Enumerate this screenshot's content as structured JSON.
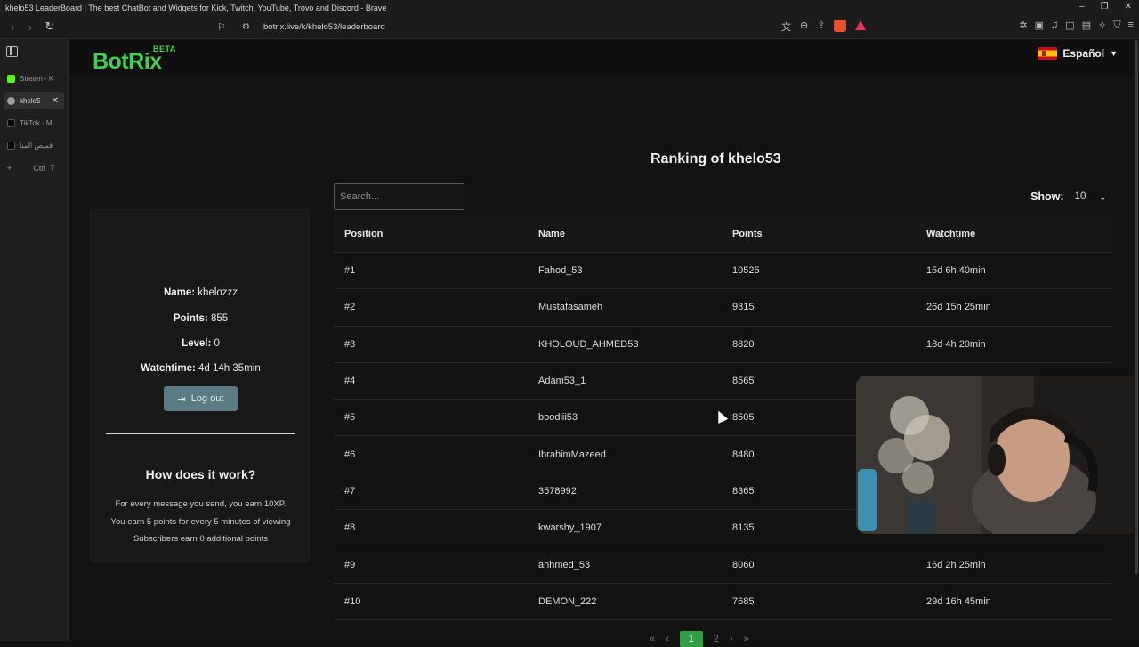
{
  "browser": {
    "window_title": "khelo53 LeaderBoard | The best ChatBot and Widgets for Kick, Twitch, YouTube, Trovo and Discord - Brave",
    "url": "botrix.live/k/khelo53/leaderboard",
    "tabs": [
      {
        "label": "Stream - K",
        "color": "#53fc18"
      },
      {
        "label": "khelo5",
        "color": "#9aa0a6"
      },
      {
        "label": "TikTok - M",
        "color": "#111111"
      },
      {
        "label": "قميص المنا",
        "color": "#111111"
      }
    ],
    "new_tab_shortcut_a": "Ctrl",
    "new_tab_shortcut_b": "T"
  },
  "header": {
    "logo": "BotRix",
    "badge": "BETA",
    "language": "Español"
  },
  "profile": {
    "name_label": "Name:",
    "name": "khelozzz",
    "points_label": "Points:",
    "points": "855",
    "level_label": "Level:",
    "level": "0",
    "watchtime_label": "Watchtime:",
    "watchtime": "4d 14h 35min",
    "logout": "Log out"
  },
  "how": {
    "title": "How does it work?",
    "lines": [
      "For every message you send, you earn 10XP.",
      "You earn 5 points for every 5 minutes of viewing",
      "Subscribers earn 0 additional points"
    ]
  },
  "ranking": {
    "title": "Ranking of khelo53",
    "search_placeholder": "Search...",
    "show_label": "Show:",
    "show_value": "10",
    "columns": [
      "Position",
      "Name",
      "Points",
      "Watchtime"
    ],
    "rows": [
      [
        "#1",
        "Fahod_53",
        "10525",
        "15d 6h 40min"
      ],
      [
        "#2",
        "Mustafasameh",
        "9315",
        "26d 15h 25min"
      ],
      [
        "#3",
        "KHOLOUD_AHMED53",
        "8820",
        "18d 4h 20min"
      ],
      [
        "#4",
        "Adam53_1",
        "8565",
        ""
      ],
      [
        "#5",
        "boodiii53",
        "8505",
        ""
      ],
      [
        "#6",
        "IbrahimMazeed",
        "8480",
        ""
      ],
      [
        "#7",
        "3578992",
        "8365",
        ""
      ],
      [
        "#8",
        "kwarshy_1907",
        "8135",
        ""
      ],
      [
        "#9",
        "ahhmed_53",
        "8060",
        "16d 2h 25min"
      ],
      [
        "#10",
        "DEMON_222",
        "7685",
        "29d 16h 45min"
      ]
    ],
    "pager": {
      "current": "1",
      "next_page": "2"
    }
  },
  "colors": {
    "brand": "#3fd24f",
    "page_bg": "#121212",
    "button": "#5a7a86",
    "pager_active": "#2ea043"
  }
}
